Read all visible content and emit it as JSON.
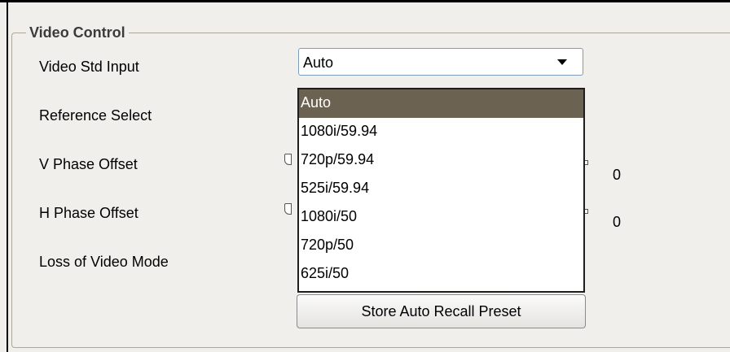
{
  "group": {
    "title": "Video Control"
  },
  "labels": {
    "video_std_input": "Video Std Input",
    "reference_select": "Reference Select",
    "v_phase_offset": "V Phase Offset",
    "h_phase_offset": "H Phase Offset",
    "loss_of_video_mode": "Loss of Video Mode"
  },
  "video_std_combo": {
    "value": "Auto",
    "open": true
  },
  "dropdown": {
    "options": [
      "Auto",
      "1080i/59.94",
      "720p/59.94",
      "525i/59.94",
      "1080i/50",
      "720p/50",
      "625i/50"
    ],
    "selected_index": 0
  },
  "v_phase_offset": {
    "value": "0"
  },
  "h_phase_offset": {
    "value": "0"
  },
  "buttons": {
    "store_auto_recall_preset": "Store Auto Recall Preset"
  },
  "colors": {
    "selection": "#6b6252",
    "combo_border": "#7f9db9",
    "panel_background": "#f0efec"
  }
}
